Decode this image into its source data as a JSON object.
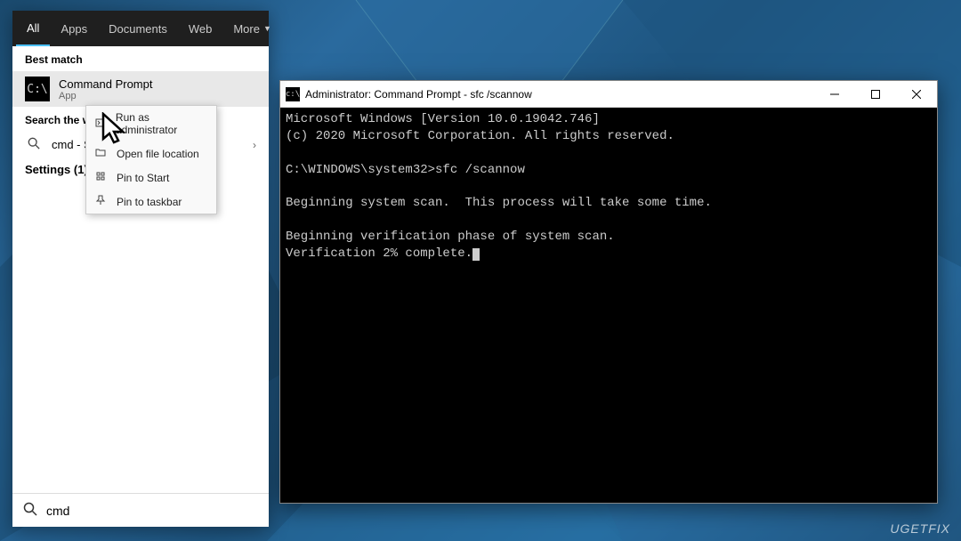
{
  "search": {
    "tabs": [
      "All",
      "Apps",
      "Documents",
      "Web",
      "More"
    ],
    "active_tab": 0,
    "best_match_label": "Best match",
    "best_match": {
      "title": "Command Prompt",
      "subtitle": "App",
      "icon_text": "C:\\"
    },
    "search_web_label": "Search the web",
    "web_item": "cmd - See web results",
    "web_item_short": "cmd - Se",
    "settings_label": "Settings (1)",
    "input_value": "cmd"
  },
  "context_menu": {
    "items": [
      {
        "icon": "admin-icon",
        "label": "Run as administrator"
      },
      {
        "icon": "folder-icon",
        "label": "Open file location"
      },
      {
        "icon": "pin-start-icon",
        "label": "Pin to Start"
      },
      {
        "icon": "pin-taskbar-icon",
        "label": "Pin to taskbar"
      }
    ]
  },
  "terminal": {
    "title": "Administrator: Command Prompt - sfc  /scannow",
    "lines": [
      "Microsoft Windows [Version 10.0.19042.746]",
      "(c) 2020 Microsoft Corporation. All rights reserved.",
      "",
      "C:\\WINDOWS\\system32>sfc /scannow",
      "",
      "Beginning system scan.  This process will take some time.",
      "",
      "Beginning verification phase of system scan.",
      "Verification 2% complete."
    ]
  },
  "watermark": "UGETFIX"
}
